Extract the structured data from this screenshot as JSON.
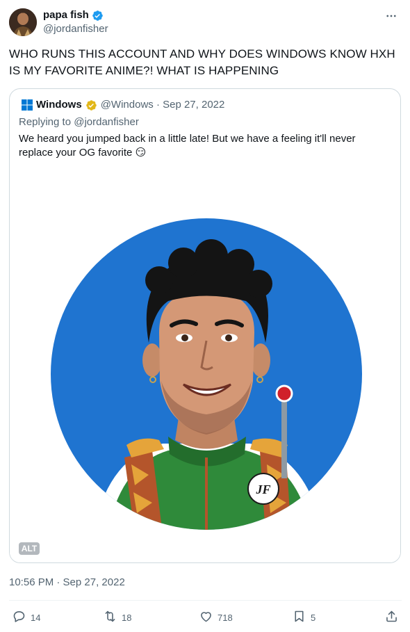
{
  "author": {
    "display_name": "papa fish",
    "handle": "@jordanfisher"
  },
  "tweet_text": "WHO RUNS THIS ACCOUNT AND WHY DOES WINDOWS KNOW HXH IS MY FAVORITE ANIME?! WHAT IS HAPPENING",
  "quoted": {
    "display_name": "Windows",
    "handle_and_date": "@Windows · Sep 27, 2022",
    "replying_to": "Replying to @jordanfisher",
    "text": "We heard you jumped back in a little late! But we have a feeling it'll never replace your OG favorite 😏",
    "alt_label": "ALT",
    "image_mark": "JF"
  },
  "timestamp": "10:56 PM · Sep 27, 2022",
  "actions": {
    "replies": "14",
    "reposts": "18",
    "likes": "718",
    "bookmarks": "5"
  },
  "colors": {
    "verified_blue": "#1d9bf0",
    "gold_badge": "#e2b719",
    "secondary_text": "#536471",
    "windows_blue": "#0078d4",
    "image_bg": "#1f74d0"
  },
  "icons": [
    "verified-badge-icon",
    "more-icon",
    "windows-logo-icon",
    "gold-check-icon",
    "reply-icon",
    "repost-icon",
    "like-icon",
    "bookmark-icon",
    "share-icon"
  ]
}
